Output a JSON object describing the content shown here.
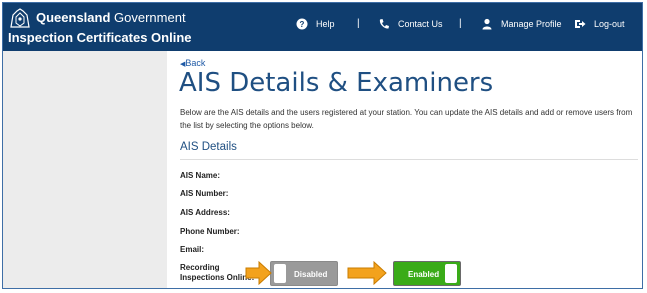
{
  "header": {
    "gov_bold": "Queensland",
    "gov_rest": " Government",
    "app_title": "Inspection Certificates Online",
    "nav": [
      {
        "label": "Help",
        "icon": "help-icon"
      },
      {
        "label": "Contact Us",
        "icon": "phone-icon"
      },
      {
        "label": "Manage Profile",
        "icon": "user-icon"
      },
      {
        "label": "Log-out",
        "icon": "logout-icon"
      }
    ],
    "separator": "|"
  },
  "main": {
    "back_label": "Back",
    "title": "AIS Details & Examiners",
    "intro": "Below are the AIS details and the users registered at your station. You can update the AIS details and add or remove users from the list by selecting the options below.",
    "section_title": "AIS Details",
    "fields": [
      {
        "label": "AIS Name:"
      },
      {
        "label": "AIS Number:"
      },
      {
        "label": "AIS Address:"
      },
      {
        "label": "Phone Number:"
      },
      {
        "label": "Email:"
      }
    ],
    "recording_label": "Recording Inspections Online:",
    "toggle_disabled_label": "Disabled",
    "toggle_enabled_label": "Enabled"
  },
  "colors": {
    "header_bg": "#0f3d6e",
    "title_blue": "#1f4f82",
    "enabled_green": "#3aab18",
    "disabled_gray": "#9a9a9a",
    "arrow_orange": "#f3a21d"
  }
}
